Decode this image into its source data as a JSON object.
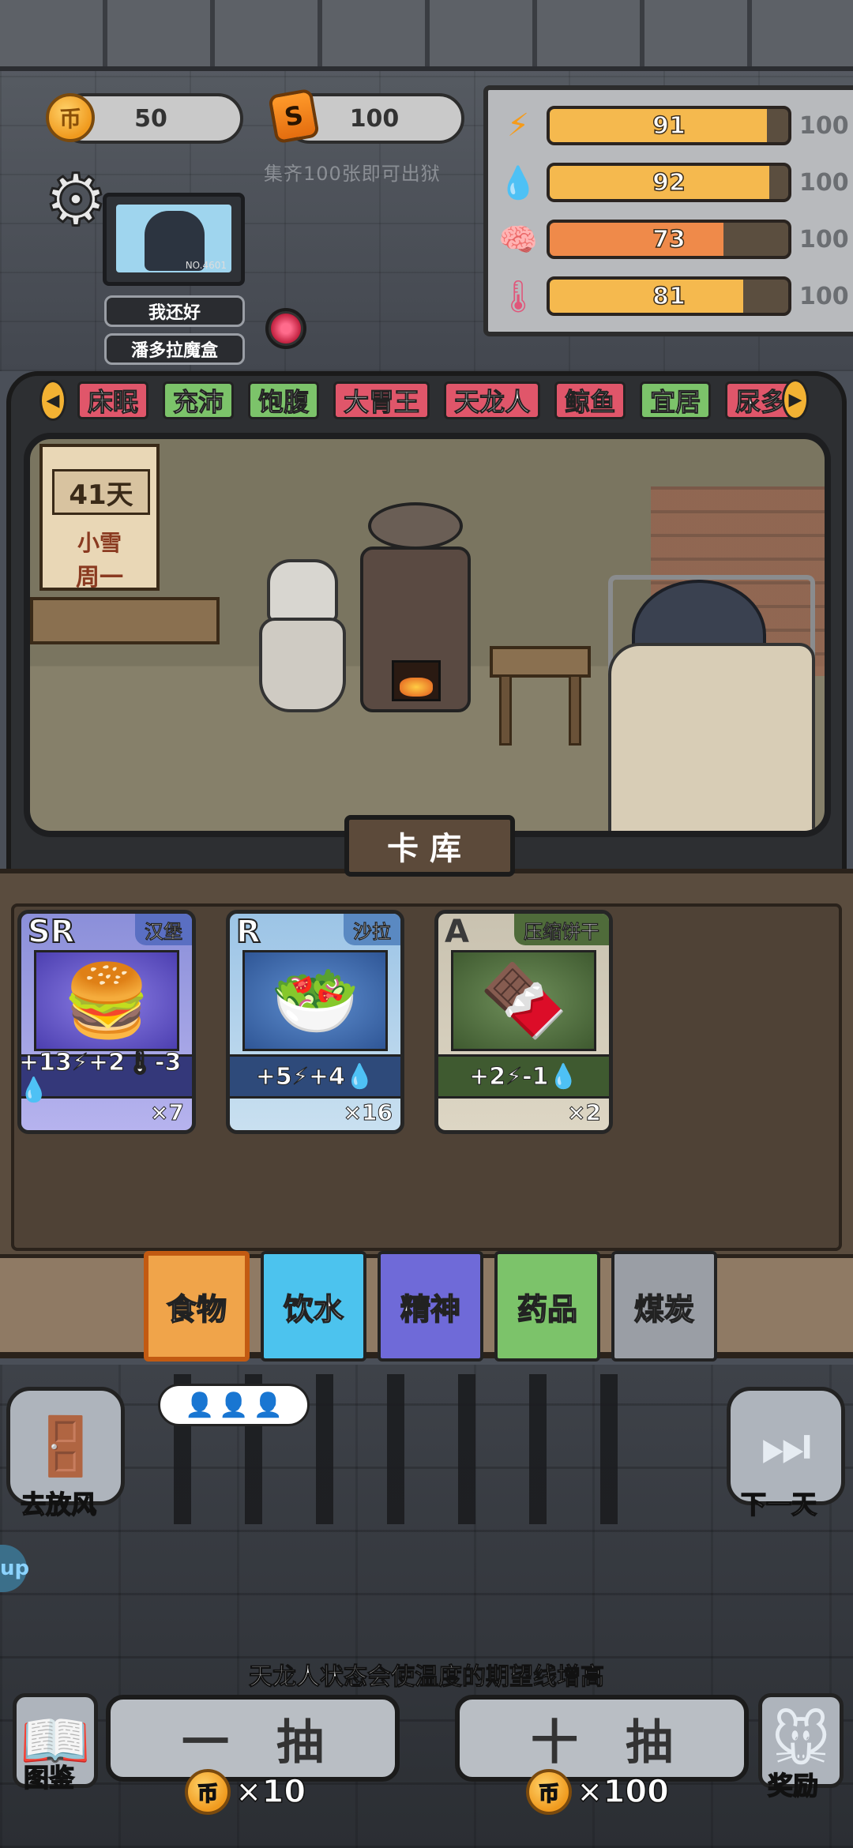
{
  "currency": {
    "coin_icon": "币",
    "coin_value": "50",
    "s_icon": "S",
    "s_value": "100",
    "collect_hint": "集齐100张即可出狱"
  },
  "stats": [
    {
      "icon": "lightning-icon",
      "glyph": "⚡",
      "value": "91",
      "max": "100",
      "fill": 0.91,
      "color": "#f5b94e"
    },
    {
      "icon": "water-drop-icon",
      "glyph": "💧",
      "value": "92",
      "max": "100",
      "fill": 0.92,
      "color": "#f5b94e"
    },
    {
      "icon": "brain-icon",
      "glyph": "🧠",
      "value": "73",
      "max": "100",
      "fill": 0.73,
      "color": "#ef8a4a"
    },
    {
      "icon": "thermometer-icon",
      "glyph": "🌡",
      "value": "81",
      "max": "100",
      "fill": 0.81,
      "color": "#f5b94e"
    }
  ],
  "player": {
    "monitor_no": "NO.4601",
    "status_button": "我还好",
    "box_button": "潘多拉魔盒"
  },
  "traits": [
    {
      "label": "床眠",
      "color": "red"
    },
    {
      "label": "充沛",
      "color": "green"
    },
    {
      "label": "饱腹",
      "color": "green"
    },
    {
      "label": "大胃王",
      "color": "red"
    },
    {
      "label": "天龙人",
      "color": "red"
    },
    {
      "label": "鲸鱼",
      "color": "red"
    },
    {
      "label": "宜居",
      "color": "green"
    },
    {
      "label": "尿多",
      "color": "red"
    }
  ],
  "calendar": {
    "day": "41天",
    "weather": "小雪",
    "weekday": "周一"
  },
  "card_library": {
    "title": "卡库",
    "cards": [
      {
        "rank": "SR",
        "name": "汉堡",
        "effect": "+13⚡+2🌡-3💧",
        "count": "×7",
        "art": "🍔"
      },
      {
        "rank": "R",
        "name": "沙拉",
        "effect": "+5⚡+4💧",
        "count": "×16",
        "art": "🥗"
      },
      {
        "rank": "A",
        "name": "压缩饼干",
        "effect": "+2⚡-1💧",
        "count": "×2",
        "art": "🍫"
      }
    ]
  },
  "categories": [
    {
      "label": "食物",
      "color": "#f0a44a",
      "active": true
    },
    {
      "label": "饮水",
      "color": "#4cc3ee",
      "active": false
    },
    {
      "label": "精神",
      "color": "#6f6ad8",
      "active": false
    },
    {
      "label": "药品",
      "color": "#7cc36a",
      "active": false
    },
    {
      "label": "煤炭",
      "color": "#9a9ea5",
      "active": false
    }
  ],
  "actions": {
    "go_out": "去放风",
    "next_day": "下一天",
    "side_tab": "up",
    "hint": "天龙人状态会使温度的期望线增高",
    "draw_one": "一抽",
    "draw_ten": "十抽",
    "draw_one_cost": "×10",
    "draw_ten_cost": "×100",
    "codex": "图鉴",
    "reward": "奖励"
  }
}
